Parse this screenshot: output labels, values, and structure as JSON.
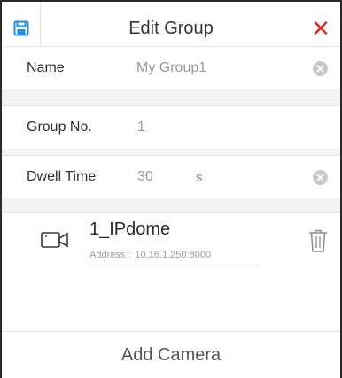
{
  "header": {
    "title": "Edit Group",
    "close_symbol": "✕"
  },
  "form": {
    "name": {
      "label": "Name",
      "value": "My Group1"
    },
    "group_no": {
      "label": "Group No.",
      "value": "1"
    },
    "dwell_time": {
      "label": "Dwell Time",
      "value": "30",
      "unit": "s"
    }
  },
  "cameras": [
    {
      "name": "1_IPdome",
      "address_label": "Address",
      "address_sep": ":",
      "address": "10.16.1.250:8000"
    }
  ],
  "add_camera_label": "Add Camera",
  "icons": {
    "save": "save-icon",
    "close": "close-icon",
    "clear": "clear-icon",
    "camera": "camera-icon",
    "trash": "trash-icon"
  },
  "colors": {
    "accent_blue": "#1f8ee6",
    "close_red": "#e0281f",
    "placeholder_gray": "#9a9a9a"
  }
}
